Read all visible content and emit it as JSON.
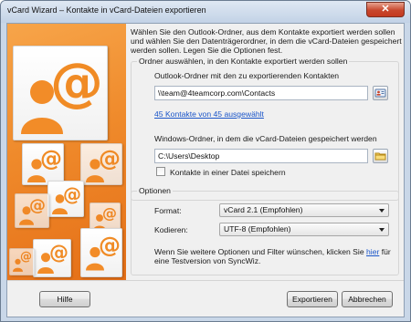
{
  "window": {
    "title": "vCard Wizard – Kontakte in vCard-Dateien exportieren",
    "close_glyph": "✕"
  },
  "intro": "Wählen Sie den Outlook-Ordner, aus dem Kontakte exportiert werden sollen und wählen Sie den Datenträgerordner, in dem die vCard-Dateien gespeichert werden sollen. Legen Sie die Optionen fest.",
  "folders": {
    "legend": "Ordner auswählen, in den Kontakte exportiert werden sollen",
    "outlook_label": "Outlook-Ordner mit den zu exportierenden Kontakten",
    "outlook_value": "\\\\team@4teamcorp.com\\Contacts",
    "selected_link": "45 Kontakte von 45 ausgewählt",
    "windows_label": "Windows-Ordner, in dem die vCard-Dateien gespeichert werden",
    "windows_value": "C:\\Users\\Desktop",
    "single_file_label": "Kontakte in einer Datei speichern",
    "single_file_checked": false
  },
  "options": {
    "legend": "Optionen",
    "format_label": "Format:",
    "format_value": "vCard 2.1 (Empfohlen)",
    "encoding_label": "Kodieren:",
    "encoding_value": "UTF-8 (Empfohlen)",
    "footer_pre": "Wenn Sie weitere Optionen und Filter wünschen, klicken Sie ",
    "footer_link": "hier",
    "footer_post": " für",
    "footer_line2": "eine Testversion von SyncWiz."
  },
  "buttons": {
    "help": "Hilfe",
    "export": "Exportieren",
    "cancel": "Abbrechen"
  },
  "colors": {
    "accent_orange": "#ef8a2b",
    "link_blue": "#1a55c9"
  }
}
